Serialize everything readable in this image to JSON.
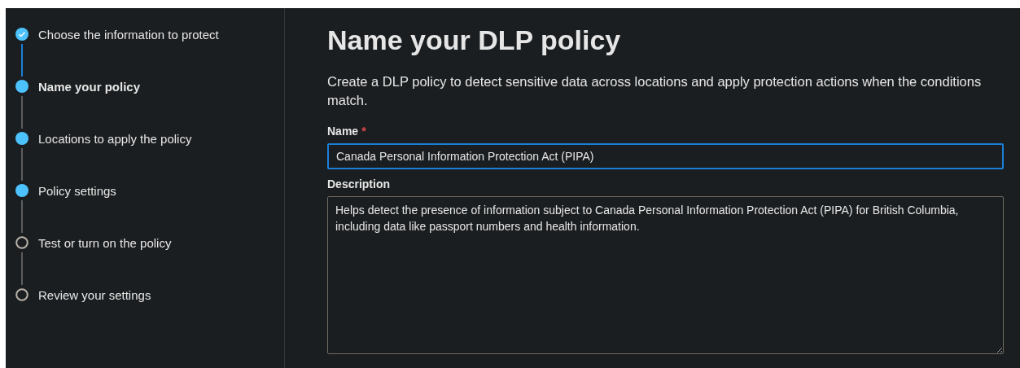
{
  "steps": [
    {
      "label": "Choose the information to protect",
      "completed": true,
      "selected": false
    },
    {
      "label": "Name your policy",
      "completed": false,
      "reached": true,
      "selected": true
    },
    {
      "label": "Locations to apply the policy",
      "completed": false,
      "reached": true,
      "selected": false
    },
    {
      "label": "Policy settings",
      "completed": false,
      "reached": true,
      "selected": false
    },
    {
      "label": "Test or turn on the policy",
      "completed": false,
      "reached": false,
      "selected": false
    },
    {
      "label": "Review your settings",
      "completed": false,
      "reached": false,
      "selected": false
    }
  ],
  "title": "Name your DLP policy",
  "intro": "Create a DLP policy to detect sensitive data across locations and apply protection actions when the conditions match.",
  "name_field": {
    "label": "Name",
    "required_mark": "*",
    "value": "Canada Personal Information Protection Act (PIPA)",
    "focused": true
  },
  "description_field": {
    "label": "Description",
    "value": "Helps detect the presence of information subject to Canada Personal Information Protection Act (PIPA) for British Columbia, including data like passport numbers and health information."
  }
}
